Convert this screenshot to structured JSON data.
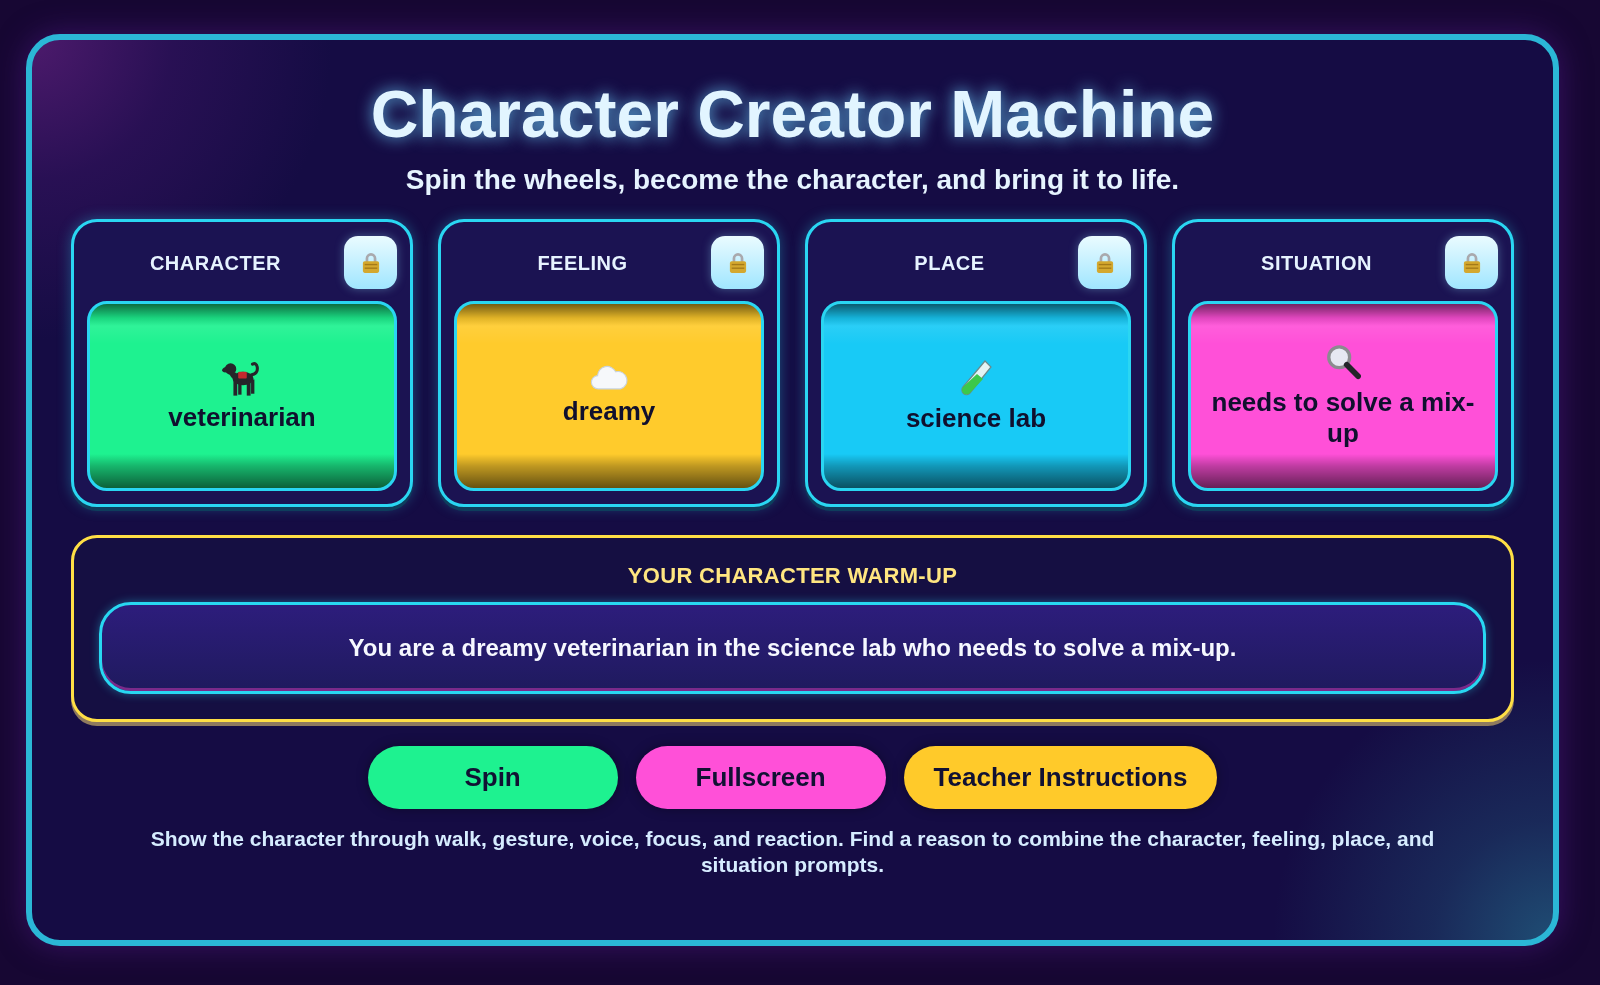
{
  "title": "Character Creator Machine",
  "subtitle": "Spin the wheels, become the character, and bring it to life.",
  "wheels": [
    {
      "label": "CHARACTER",
      "value": "veterinarian",
      "kind": "dog",
      "color": "#1ef290"
    },
    {
      "label": "FEELING",
      "value": "dreamy",
      "kind": "cloud",
      "color": "#ffcb2c"
    },
    {
      "label": "PLACE",
      "value": "science lab",
      "kind": "tube",
      "color": "#18caf6"
    },
    {
      "label": "SITUATION",
      "value": "needs to solve a mix-up",
      "kind": "magnifier",
      "color": "#ff50d8"
    }
  ],
  "warmup": {
    "heading": "YOUR CHARACTER WARM-UP",
    "text": "You are a dreamy veterinarian in the science lab who needs to solve a mix-up."
  },
  "buttons": [
    {
      "label": "Spin",
      "color": "#1ef290"
    },
    {
      "label": "Fullscreen",
      "color": "#ff50d8"
    },
    {
      "label": "Teacher Instructions",
      "color": "#ffca2a"
    }
  ],
  "footer": "Show the character through walk, gesture, voice, focus, and reaction. Find a reason to combine the character, feeling, place, and situation prompts."
}
